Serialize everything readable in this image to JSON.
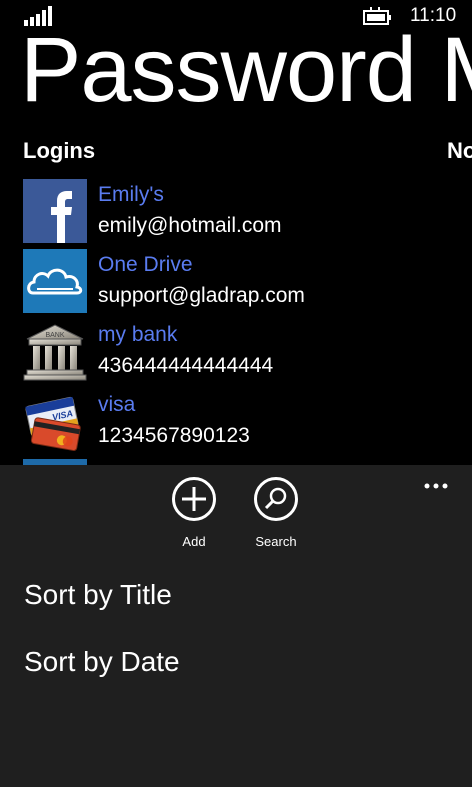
{
  "status_bar": {
    "time": "11:10",
    "signal_icon": "signal-strength-icon",
    "battery_icon": "battery-charging-icon"
  },
  "app": {
    "title": "Password M"
  },
  "pivot": {
    "current": "Logins",
    "next": "No"
  },
  "logins": [
    {
      "title": "Emily's",
      "detail": "emily@hotmail.com",
      "icon": "facebook-icon"
    },
    {
      "title": "One Drive",
      "detail": "support@gladrap.com",
      "icon": "onedrive-cloud-icon"
    },
    {
      "title": "my bank",
      "detail": "436444444444444",
      "icon": "bank-icon",
      "icon_text": "BANK"
    },
    {
      "title": "visa",
      "detail": "1234567890123",
      "icon": "credit-card-icon",
      "icon_text": "VISA"
    }
  ],
  "appbar": {
    "more_icon": "more-dots-icon",
    "buttons": [
      {
        "label": "Add",
        "icon": "add-icon"
      },
      {
        "label": "Search",
        "icon": "search-icon"
      }
    ],
    "menu": [
      "Sort by Title",
      "Sort by Date"
    ]
  },
  "colors": {
    "background": "#000000",
    "appbar": "#1f1f1f",
    "accent_link": "#5a7cf0",
    "facebook": "#3b5998",
    "onedrive": "#1e79b8"
  }
}
